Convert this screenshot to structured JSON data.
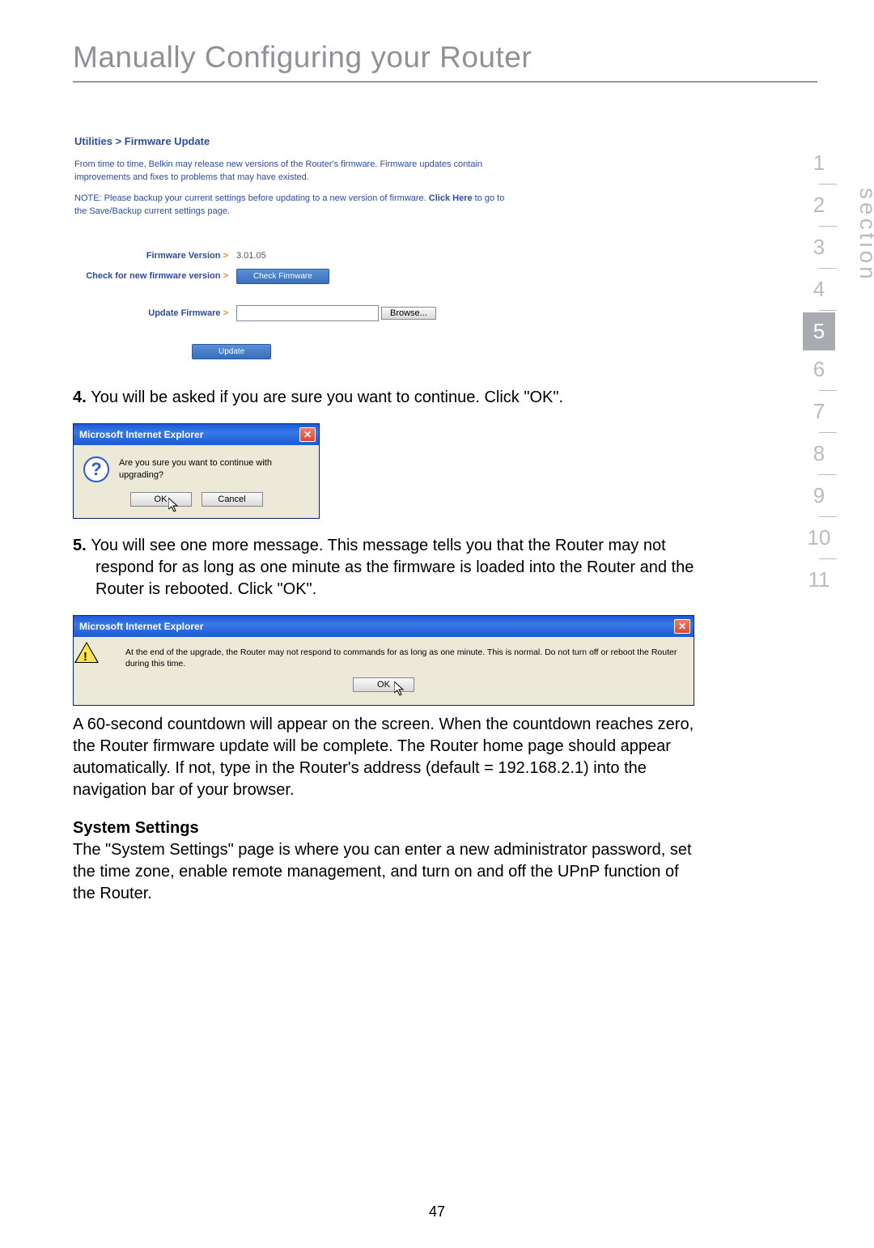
{
  "page_title": "Manually Configuring your Router",
  "router": {
    "breadcrumb": "Utilities > Firmware Update",
    "description": "From time to time, Belkin may release new versions of the Router's firmware. Firmware updates contain improvements and fixes to problems that may have existed.",
    "note_prefix": "NOTE: Please backup your current settings before updating to a new version of firmware. ",
    "note_link": "Click Here",
    "note_suffix": " to go to the Save/Backup current settings page.",
    "labels": {
      "version": "Firmware Version",
      "check": "Check for new firmware version",
      "update": "Update Firmware"
    },
    "version_value": "3.01.05",
    "check_button": "Check Firmware",
    "browse_button": "Browse...",
    "update_button": "Update"
  },
  "steps": {
    "s4_num": "4. ",
    "s4_text": "You will be asked if you are sure you want to continue. Click \"OK\".",
    "s5_num": "5. ",
    "s5_text": "You will see one more message. This message tells you that the Router may not respond for as long as one minute as the firmware is loaded into the Router and the Router is rebooted. Click \"OK\"."
  },
  "dialog1": {
    "title": "Microsoft Internet Explorer",
    "message": "Are you sure you want to continue with upgrading?",
    "ok": "OK",
    "cancel": "Cancel"
  },
  "dialog2": {
    "title": "Microsoft Internet Explorer",
    "message": "At the end of the upgrade, the Router may not respond to commands for as long as one minute. This is normal. Do not turn off or reboot the Router during this time.",
    "ok": "OK"
  },
  "para_countdown": "A 60-second countdown will appear on the screen. When the countdown reaches zero, the Router firmware update will be complete. The Router home page should appear automatically. If not, type in the Router's address (default = 192.168.2.1) into the navigation bar of your browser.",
  "system_settings_head": "System Settings",
  "system_settings_body": "The \"System Settings\" page is where you can enter a new administrator password, set the time zone, enable remote management, and turn on and off the UPnP function of the Router.",
  "section_label": "section",
  "nav": {
    "items": [
      "1",
      "2",
      "3",
      "4",
      "5",
      "6",
      "7",
      "8",
      "9",
      "10",
      "11"
    ],
    "active": "5"
  },
  "page_number": "47"
}
